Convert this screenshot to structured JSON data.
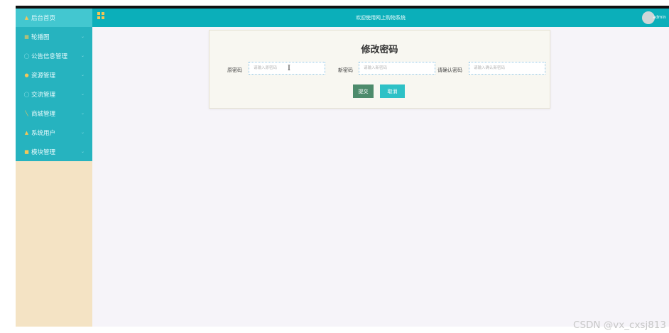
{
  "header": {
    "title": "欢迎使用网上购物系统",
    "username": "admin"
  },
  "sidebar": {
    "items": [
      {
        "label": "后台首页",
        "icon": "home-icon",
        "has_submenu": false
      },
      {
        "label": "轮播图",
        "icon": "picture-icon",
        "has_submenu": true
      },
      {
        "label": "公告信息管理",
        "icon": "notice-icon",
        "has_submenu": true
      },
      {
        "label": "资源管理",
        "icon": "resource-icon",
        "has_submenu": true
      },
      {
        "label": "交流管理",
        "icon": "chat-icon",
        "has_submenu": true
      },
      {
        "label": "商城管理",
        "icon": "cart-icon",
        "has_submenu": true
      },
      {
        "label": "系统用户",
        "icon": "user-icon",
        "has_submenu": true
      },
      {
        "label": "模块管理",
        "icon": "module-icon",
        "has_submenu": true
      }
    ]
  },
  "form": {
    "title": "修改密码",
    "fields": [
      {
        "label": "原密码",
        "placeholder": "请输入原密码",
        "value": ""
      },
      {
        "label": "新密码",
        "placeholder": "请输入新密码",
        "value": ""
      },
      {
        "label": "请确认密码",
        "placeholder": "请输入确认新密码",
        "value": ""
      }
    ],
    "submit_label": "提交",
    "cancel_label": "取消"
  },
  "watermark": "CSDN @vx_cxsj813",
  "colors": {
    "header_bg": "#0bafba",
    "sidebar_menu_bg": "#26b3bf",
    "sidebar_bg": "#f4e3c4",
    "submit_button": "#4d8b6c",
    "cancel_button": "#2ec1c6",
    "main_bg": "#f6f4f9"
  }
}
